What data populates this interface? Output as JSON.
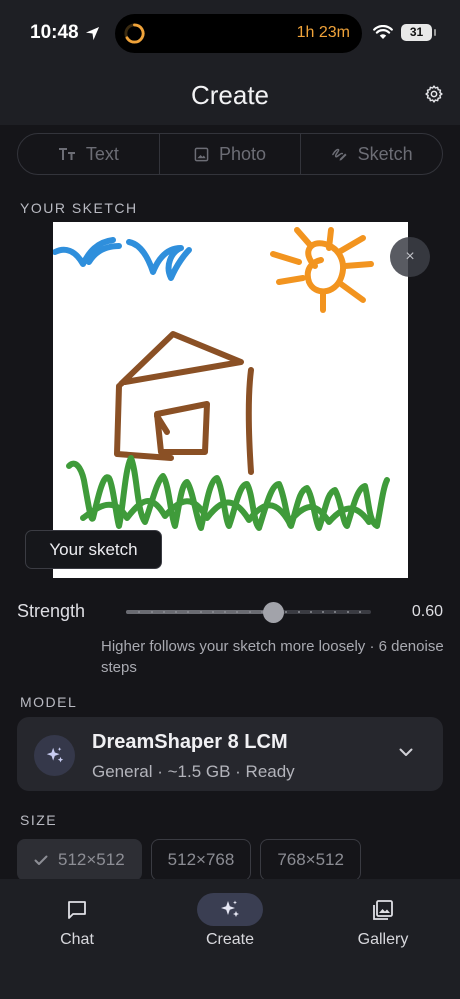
{
  "status_bar": {
    "time": "10:48",
    "timer": "1h 23m",
    "battery": "31"
  },
  "header": {
    "title": "Create"
  },
  "mode_tabs": [
    {
      "label": "Text",
      "icon": "text-icon"
    },
    {
      "label": "Photo",
      "icon": "photo-icon"
    },
    {
      "label": "Sketch",
      "icon": "sketch-icon"
    }
  ],
  "sketch_section": {
    "label": "YOUR SKETCH",
    "tooltip": "Your sketch",
    "clear_symbol": "×"
  },
  "strength": {
    "label": "Strength",
    "value": 0.6,
    "value_text": "0.60",
    "hint": "Higher follows your sketch more loosely · 6 denoise steps"
  },
  "model": {
    "section_label": "MODEL",
    "name": "DreamShaper 8 LCM",
    "meta": "General · ~1.5 GB · Ready",
    "icon": "sparkles-icon"
  },
  "size": {
    "section_label": "SIZE",
    "options": [
      {
        "label": "512×512",
        "selected": true
      },
      {
        "label": "512×768",
        "selected": false
      },
      {
        "label": "768×512",
        "selected": false
      }
    ]
  },
  "bottom_nav": [
    {
      "label": "Chat",
      "icon": "chat-icon",
      "active": false
    },
    {
      "label": "Create",
      "icon": "sparkles-icon",
      "active": true
    },
    {
      "label": "Gallery",
      "icon": "gallery-icon",
      "active": false
    }
  ],
  "colors": {
    "background": "#151519",
    "surface": "#1e1f24",
    "card": "#26272d",
    "accent_orange": "#f0a33a",
    "sketch_blue": "#2f8fdc",
    "sketch_orange": "#f2941f",
    "sketch_brown": "#8a5025",
    "sketch_green": "#3f9b3a"
  }
}
